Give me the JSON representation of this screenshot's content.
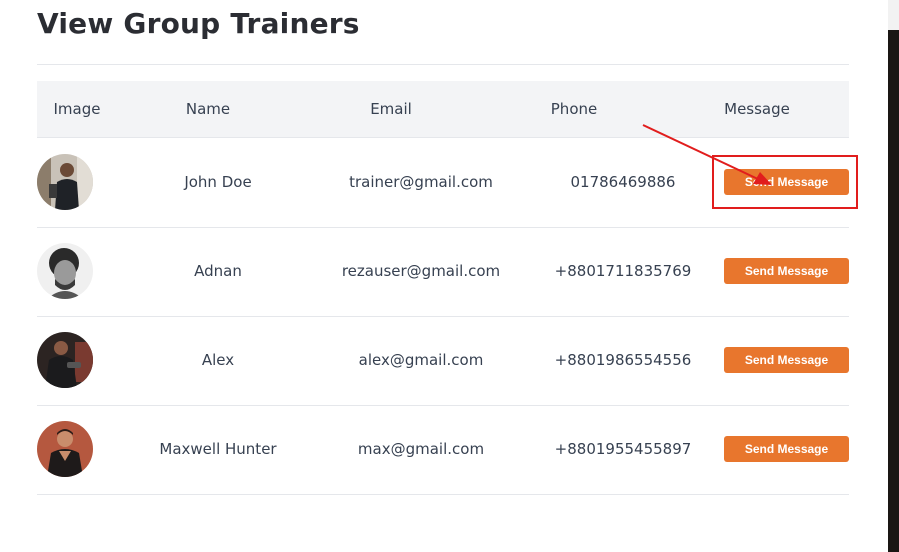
{
  "page": {
    "title": "View Group Trainers"
  },
  "table": {
    "headers": [
      "Image",
      "Name",
      "Email",
      "Phone",
      "Message"
    ],
    "rows": [
      {
        "name": "John Doe",
        "email": "trainer@gmail.com",
        "phone": "01786469886",
        "action": "Send Message",
        "avatar": "trainer-photo-1"
      },
      {
        "name": "Adnan",
        "email": "rezauser@gmail.com",
        "phone": "+8801711835769",
        "action": "Send Message",
        "avatar": "trainer-photo-2"
      },
      {
        "name": "Alex",
        "email": "alex@gmail.com",
        "phone": "+8801986554556",
        "action": "Send Message",
        "avatar": "trainer-photo-3"
      },
      {
        "name": "Maxwell Hunter",
        "email": "max@gmail.com",
        "phone": "+8801955455897",
        "action": "Send Message",
        "avatar": "trainer-photo-4"
      }
    ]
  },
  "annotation": {
    "color": "#e11d1d"
  },
  "colors": {
    "button": "#e8762d",
    "header_bg": "#f3f4f6"
  }
}
